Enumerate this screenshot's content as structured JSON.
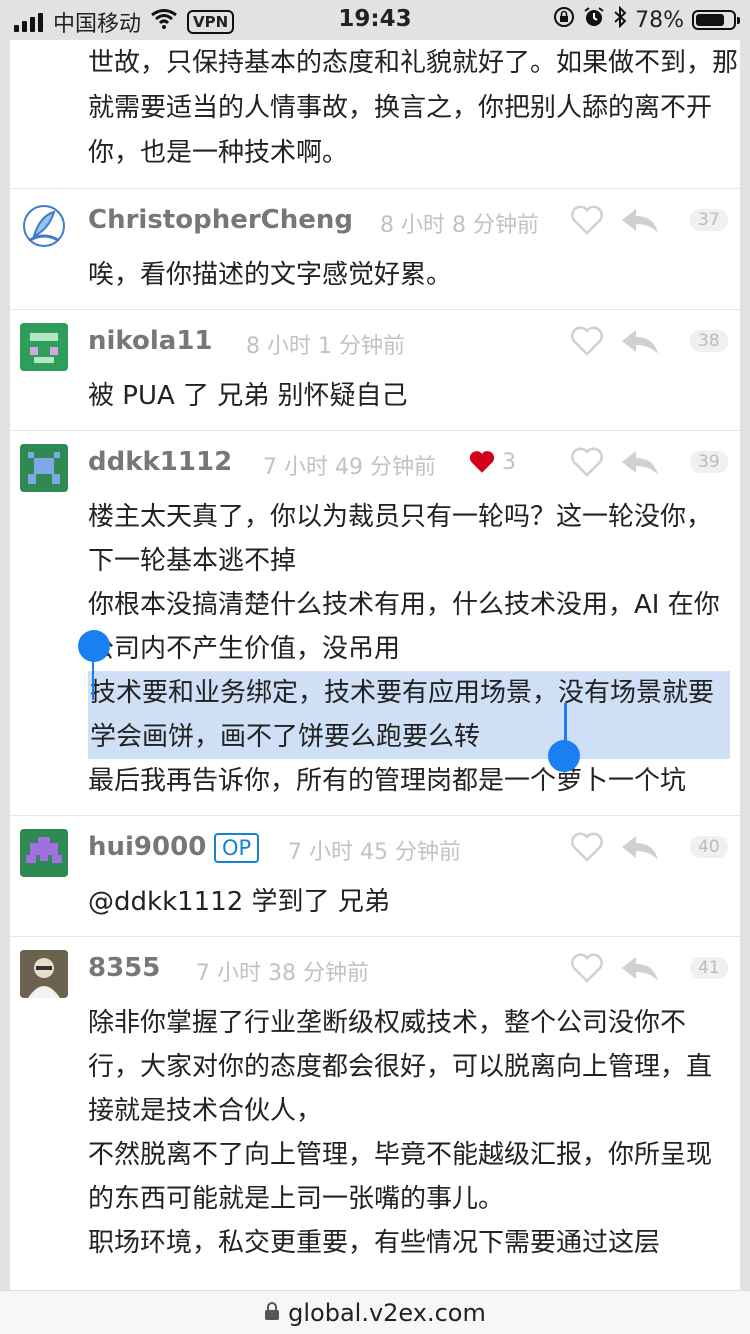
{
  "status_bar": {
    "carrier": "中国移动",
    "vpn": "VPN",
    "time": "19:43",
    "battery": "78%",
    "battery_level": 0.78
  },
  "top_text": "世故，只保持基本的态度和礼貌就好了。如果做不到，那就需要适当的人情事故，换言之，你把别人舔的离不开你，也是一种技术啊。",
  "replies": [
    {
      "author": "ChristopherCheng",
      "ago": "8 小时 8 分钟前",
      "floor": "37",
      "lines": [
        "唉，看你描述的文字感觉好累。"
      ]
    },
    {
      "author": "nikola11",
      "ago": "8 小时 1 分钟前",
      "floor": "38",
      "lines": [
        "被 PUA 了 兄弟 别怀疑自己"
      ]
    },
    {
      "author": "ddkk1112",
      "ago": "7 小时 49 分钟前",
      "thanks": "3",
      "floor": "39",
      "lines": [
        "楼主太天真了，你以为裁员只有一轮吗？这一轮没你，下一轮基本逃不掉",
        "你根本没搞清楚什么技术有用，什么技术没用，AI 在你公司内不产生价值，没吊用",
        "技术要和业务绑定，技术要有应用场景，没有场景就要学会画饼，画不了饼要么跑要么转",
        "最后我再告诉你，所有的管理岗都是一个萝卜一个坑"
      ]
    },
    {
      "author": "hui9000",
      "op_badge": "OP",
      "ago": "7 小时 45 分钟前",
      "floor": "40",
      "lines": [
        "@ddkk1112 学到了 兄弟"
      ]
    },
    {
      "author": "8355",
      "ago": "7 小时 38 分钟前",
      "floor": "41",
      "lines": [
        "除非你掌握了行业垄断级权威技术，整个公司没你不行，大家对你的态度都会很好，可以脱离向上管理，直接就是技术合伙人，",
        "不然脱离不了向上管理，毕竟不能越级汇报，你所呈现的东西可能就是上司一张嘴的事儿。",
        "职场环境，私交更重要，有些情况下需要通过这层"
      ]
    }
  ],
  "url": "global.v2ex.com",
  "colors": {
    "accent": "#1484cd",
    "selection": "#cfe0f6",
    "handle": "#1a7ff0",
    "heart": "#d0021b"
  }
}
